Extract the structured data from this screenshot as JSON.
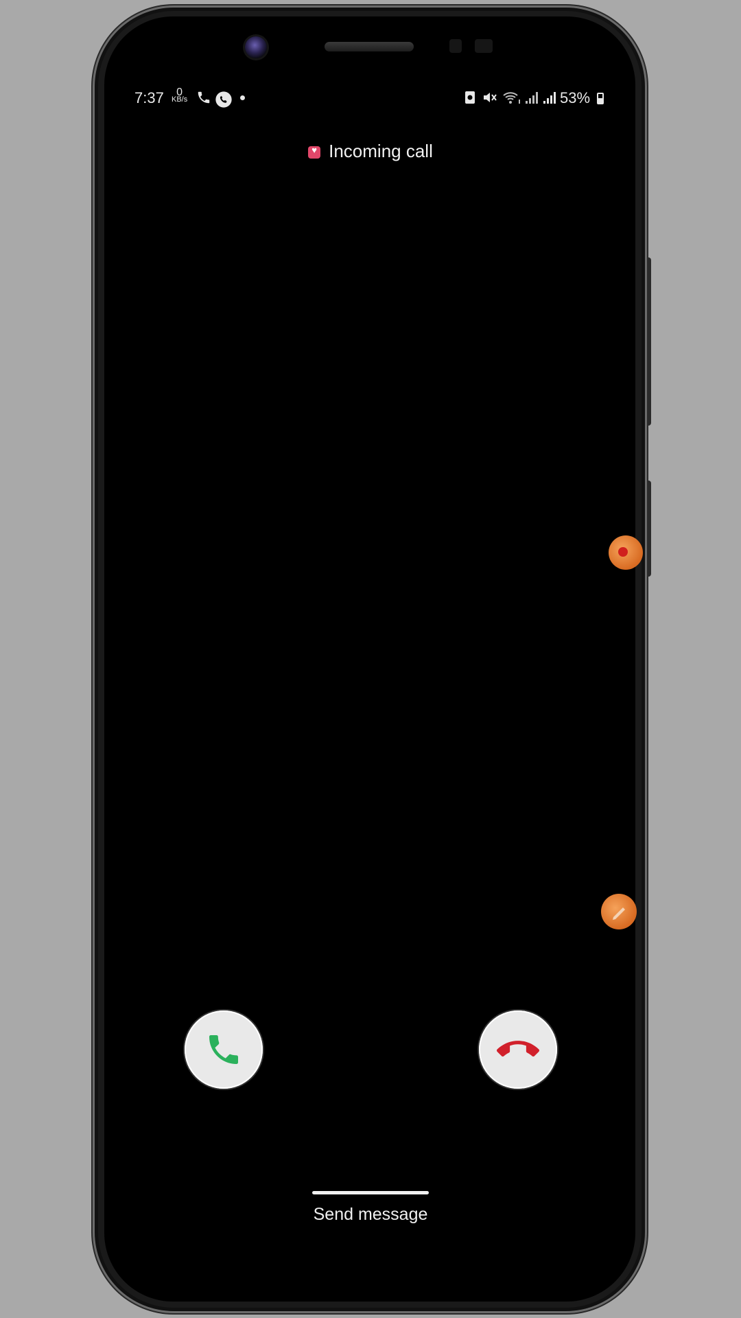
{
  "status_bar": {
    "time": "7:37",
    "net_speed_value": "0",
    "net_speed_unit": "KB/s",
    "battery_percent": "53%",
    "battery_level": 0.53,
    "left_icons": [
      "phone-call-icon",
      "whatsapp-icon",
      "notification-dot"
    ],
    "right_icons": [
      "screenshot-icon",
      "mute-icon",
      "wifi-calling-icon",
      "signal-icon-1",
      "signal-icon-2",
      "battery-icon"
    ]
  },
  "call": {
    "title": "Incoming call",
    "app_icon": "heart-app-icon",
    "accept_icon": "phone-icon",
    "decline_icon": "phone-hangup-icon",
    "accept_color": "#2bb15c",
    "decline_color": "#d1202b"
  },
  "footer": {
    "send_message": "Send message"
  },
  "floating_bubbles": [
    "recording-bubble",
    "edit-bubble"
  ],
  "colors": {
    "background": "#a9a9a9",
    "screen": "#000000",
    "bubble": "#e8852e"
  }
}
